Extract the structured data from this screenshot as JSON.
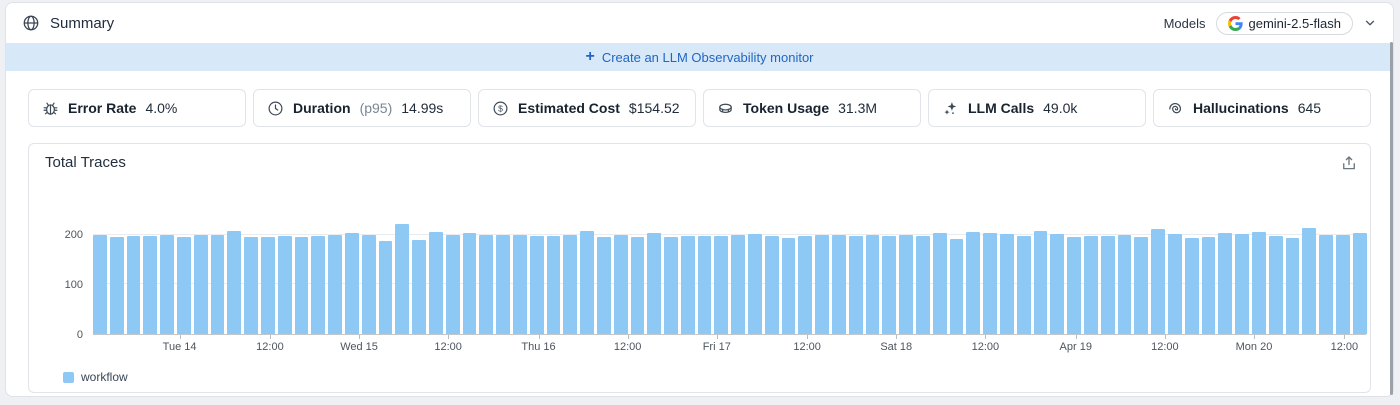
{
  "header": {
    "title": "Summary",
    "models_label": "Models",
    "model_name": "gemini-2.5-flash"
  },
  "banner": {
    "plus": "+",
    "label": "Create an LLM Observability monitor"
  },
  "stats": [
    {
      "icon": "bug-icon",
      "label": "Error Rate",
      "value": "4.0%"
    },
    {
      "icon": "clock-icon",
      "label": "Duration",
      "suffix": "(p95)",
      "value": "14.99s"
    },
    {
      "icon": "dollar-badge-icon",
      "label": "Estimated Cost",
      "value": "$154.52"
    },
    {
      "icon": "coin-icon",
      "label": "Token Usage",
      "value": "31.3M"
    },
    {
      "icon": "sparkles-icon",
      "label": "LLM Calls",
      "value": "49.0k"
    },
    {
      "icon": "spiral-icon",
      "label": "Hallucinations",
      "value": "645"
    }
  ],
  "chart": {
    "title": "Total Traces",
    "legend": [
      {
        "label": "workflow",
        "color": "#8ec8f4"
      }
    ]
  },
  "chart_data": {
    "type": "bar",
    "title": "Total Traces",
    "xlabel": "",
    "ylabel": "",
    "ylim": [
      0,
      232
    ],
    "y_ticks": [
      0,
      100,
      200
    ],
    "grid": "horizontal",
    "legend_position": "bottom-left",
    "series": [
      {
        "name": "workflow",
        "color": "#8ec8f4",
        "values": [
          200,
          196,
          197,
          198,
          200,
          196,
          199,
          199,
          208,
          196,
          195,
          198,
          196,
          198,
          199,
          204,
          199,
          187,
          221,
          189,
          206,
          200,
          203,
          199,
          200,
          199,
          198,
          197,
          200,
          208,
          196,
          199,
          195,
          204,
          196,
          198,
          197,
          198,
          200,
          202,
          198,
          194,
          197,
          199,
          200,
          197,
          199,
          197,
          200,
          198,
          204,
          191,
          206,
          204,
          201,
          197,
          207,
          201,
          196,
          197,
          197,
          200,
          196,
          212,
          201,
          193,
          196,
          204,
          201,
          206,
          198,
          193,
          213,
          200,
          199,
          203
        ]
      }
    ],
    "x_ticks": [
      {
        "label": "Tue 14",
        "pos": 0.068
      },
      {
        "label": "12:00",
        "pos": 0.139
      },
      {
        "label": "Wed 15",
        "pos": 0.209
      },
      {
        "label": "12:00",
        "pos": 0.279
      },
      {
        "label": "Thu 16",
        "pos": 0.35
      },
      {
        "label": "12:00",
        "pos": 0.42
      },
      {
        "label": "Fri 17",
        "pos": 0.49
      },
      {
        "label": "12:00",
        "pos": 0.561
      },
      {
        "label": "Sat 18",
        "pos": 0.631
      },
      {
        "label": "12:00",
        "pos": 0.701
      },
      {
        "label": "Apr 19",
        "pos": 0.772
      },
      {
        "label": "12:00",
        "pos": 0.842
      },
      {
        "label": "Mon 20",
        "pos": 0.912
      },
      {
        "label": "12:00",
        "pos": 0.983
      }
    ]
  },
  "colors": {
    "accent_blue": "#2266c2",
    "banner_bg": "#d7e9f8",
    "bar_fill": "#8ec8f4"
  }
}
